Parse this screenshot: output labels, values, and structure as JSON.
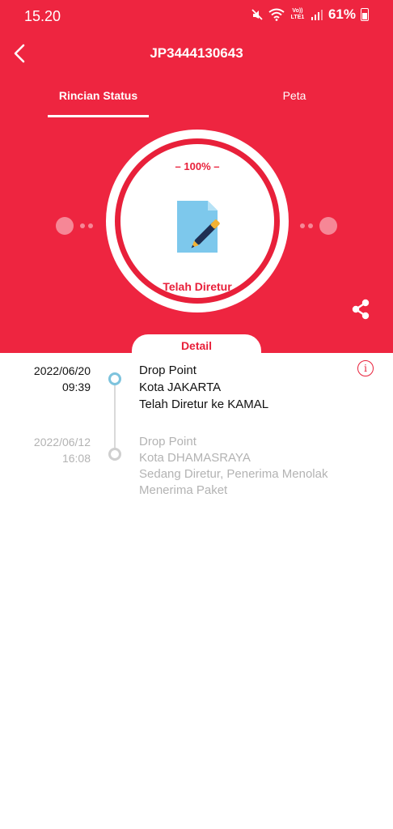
{
  "status_bar": {
    "time": "15.20",
    "network_label": "Vo)) LTE1",
    "battery": "61%"
  },
  "header": {
    "title": "JP3444130643"
  },
  "tabs": [
    {
      "label": "Rincian Status",
      "active": true
    },
    {
      "label": "Peta",
      "active": false
    }
  ],
  "progress": {
    "percent_label": "– 100% –",
    "value": 100,
    "status_label": "Telah Diretur"
  },
  "detail_tab": {
    "label": "Detail"
  },
  "timeline": [
    {
      "date": "2022/06/20",
      "time": "09:39",
      "lines": [
        "Drop Point",
        "Kota JAKARTA",
        "Telah Diretur ke KAMAL"
      ],
      "active": true
    },
    {
      "date": "2022/06/12",
      "time": "16:08",
      "lines": [
        "Drop Point",
        "Kota DHAMASRAYA",
        "Sedang Diretur, Penerima Menolak",
        "Menerima Paket"
      ],
      "active": false
    }
  ],
  "info_button": {
    "label": "i"
  },
  "colors": {
    "primary": "#EE2540",
    "accent_red": "#E8203A",
    "timeline_active": "#7DC3DD",
    "timeline_inactive": "#b3b3b3"
  },
  "icons": [
    "back-arrow-icon",
    "document-signature-icon",
    "share-icon",
    "info-icon",
    "mute-icon",
    "wifi-icon",
    "signal-icon",
    "battery-icon"
  ]
}
